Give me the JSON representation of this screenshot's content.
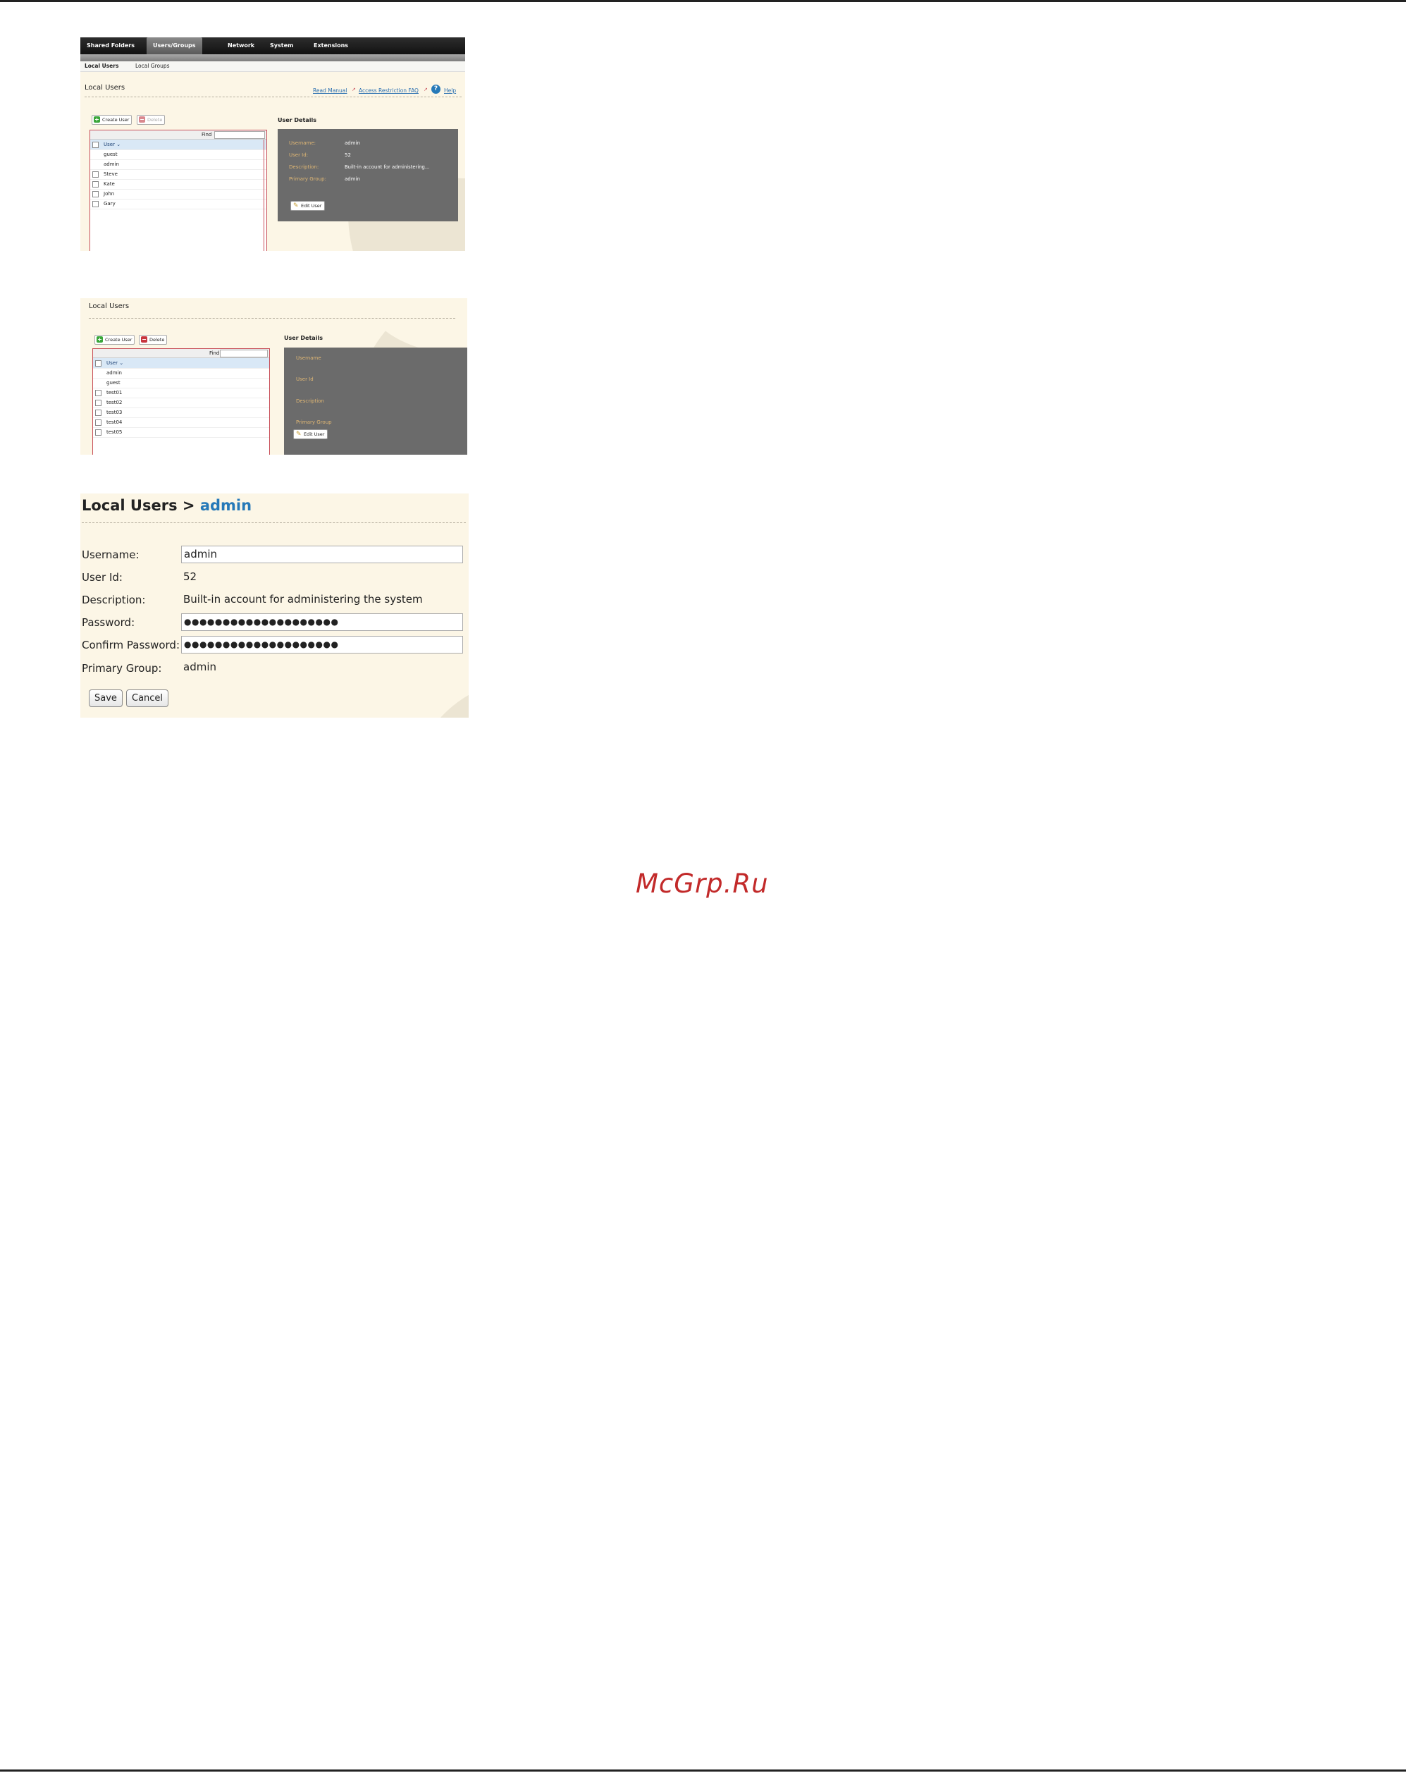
{
  "screenshot1": {
    "nav_tabs": [
      "Shared Folders",
      "Users/Groups",
      "Network",
      "System",
      "Extensions"
    ],
    "sub_tabs": [
      "Local Users",
      "Local Groups"
    ],
    "title": "Local Users",
    "links": {
      "read_manual": "Read Manual",
      "faq": "Access Restriction FAQ",
      "help": "Help"
    },
    "toolbar": {
      "create": "Create User",
      "delete": "Delete"
    },
    "find_label": "Find",
    "column_header": "User",
    "users": [
      "guest",
      "admin",
      "Steve",
      "Kate",
      "John",
      "Gary"
    ],
    "details_heading": "User Details",
    "details": {
      "username_label": "Username:",
      "username": "admin",
      "userid_label": "User Id:",
      "userid": "52",
      "description_label": "Description:",
      "description": "Built-in account for administering...",
      "group_label": "Primary Group:",
      "group": "admin"
    },
    "edit_button": "Edit User"
  },
  "screenshot2": {
    "title": "Local Users",
    "toolbar": {
      "create": "Create User",
      "delete": "Delete"
    },
    "find_label": "Find",
    "column_header": "User",
    "users": [
      "admin",
      "guest",
      "test01",
      "test02",
      "test03",
      "test04",
      "test05"
    ],
    "details_heading": "User Details",
    "details": {
      "username_label": "Username",
      "userid_label": "User Id",
      "description_label": "Description",
      "group_label": "Primary Group"
    },
    "edit_button": "Edit User"
  },
  "screenshot3": {
    "title_prefix": "Local Users >",
    "title_user": "admin",
    "fields": {
      "username_label": "Username:",
      "username": "admin",
      "userid_label": "User Id:",
      "userid": "52",
      "description_label": "Description:",
      "description": "Built-in account for administering the system",
      "password_label": "Password:",
      "password": "●●●●●●●●●●●●●●●●●●●●",
      "confirm_label": "Confirm Password:",
      "confirm": "●●●●●●●●●●●●●●●●●●●●",
      "group_label": "Primary Group:",
      "group": "admin"
    },
    "buttons": {
      "save": "Save",
      "cancel": "Cancel"
    }
  },
  "watermark": "McGrp.Ru",
  "colors": {
    "accent_link": "#2679b8",
    "panel": "#6b6b6b",
    "label_gold": "#e0b774",
    "watermark": "#c22a2a"
  }
}
